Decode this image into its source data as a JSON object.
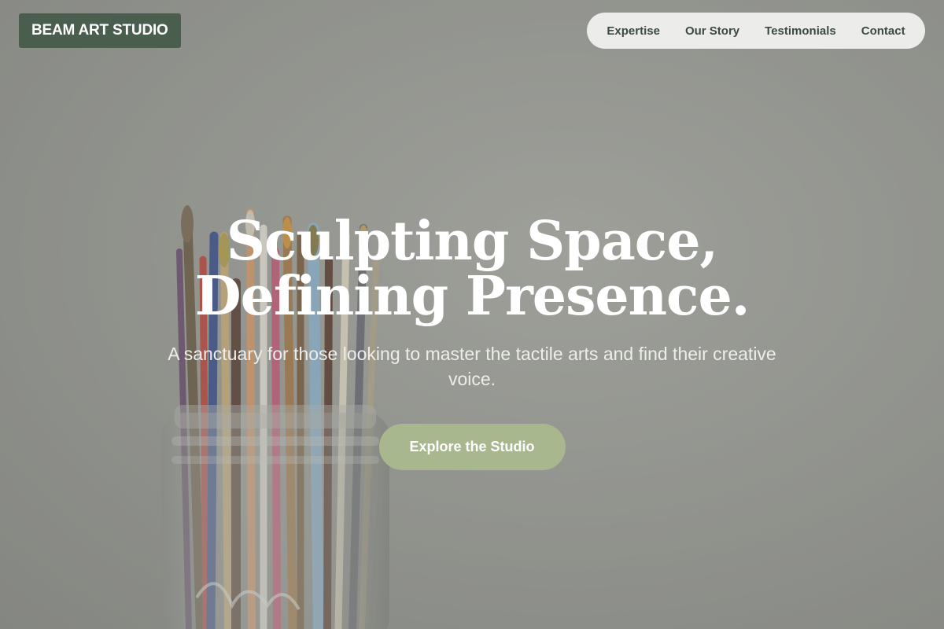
{
  "header": {
    "logo_text": "BEAM ART STUDIO",
    "nav": [
      {
        "label": "Expertise"
      },
      {
        "label": "Our Story"
      },
      {
        "label": "Testimonials"
      },
      {
        "label": "Contact"
      }
    ]
  },
  "hero": {
    "headline_line1": "Sculpting Space,",
    "headline_line2": "Defining Presence.",
    "subtitle": "A sanctuary for those looking to master the tactile arts and find their creative voice.",
    "cta_label": "Explore the Studio",
    "background_image": "jar-of-paintbrushes-photo"
  },
  "colors": {
    "logo_bg": "#4a5e4e",
    "nav_bg": "#ececea",
    "nav_text": "#3c4a41",
    "cta_bg": "#a9b78f",
    "headline": "#ffffff"
  }
}
